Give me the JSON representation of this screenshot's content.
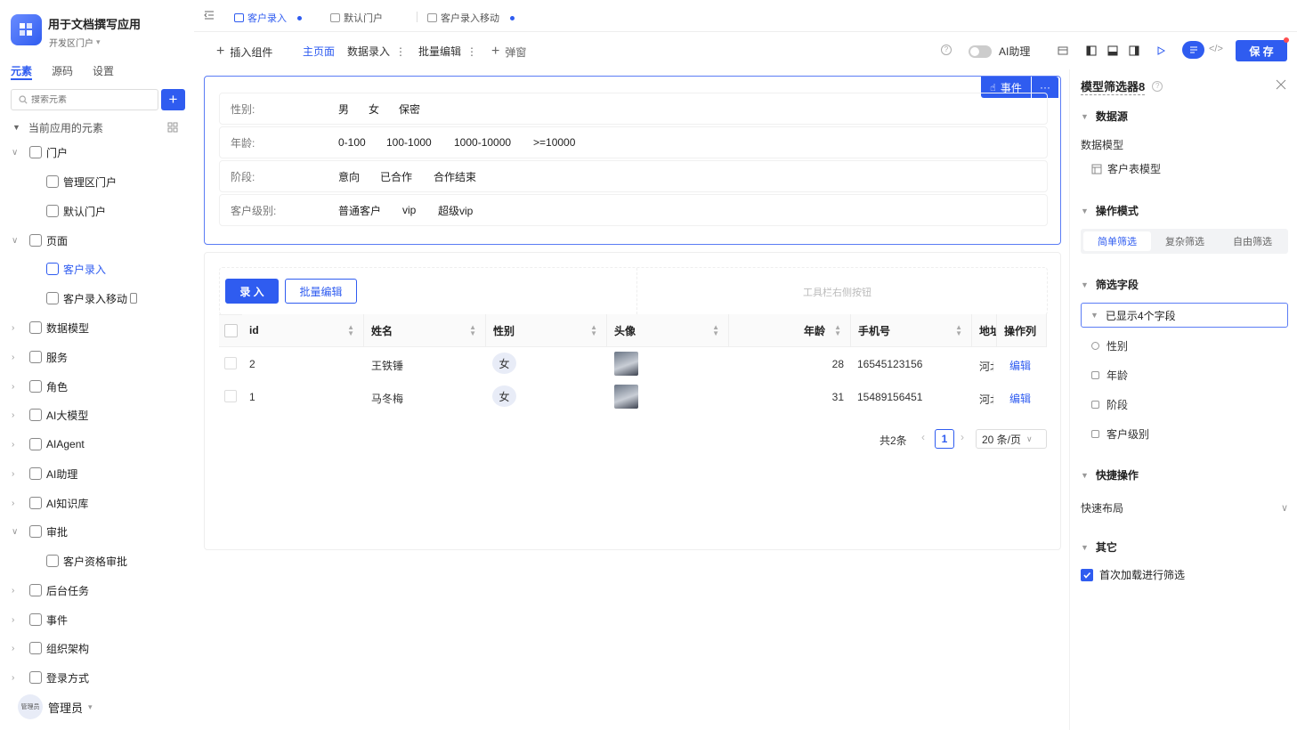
{
  "app": {
    "title": "用于文档撰写应用",
    "subtitle": "开发区门户"
  },
  "left_tabs": [
    "元素",
    "源码",
    "设置"
  ],
  "search": {
    "placeholder": "搜索元素"
  },
  "tree_header": "当前应用的元素",
  "tree": [
    {
      "label": "门户",
      "icon": "home-icon",
      "level": 0,
      "expanded": true
    },
    {
      "label": "管理区门户",
      "icon": "monitor-icon",
      "level": 1
    },
    {
      "label": "默认门户",
      "icon": "monitor-icon",
      "level": 1
    },
    {
      "label": "页面",
      "icon": "page-icon",
      "level": 0,
      "expanded": true
    },
    {
      "label": "客户录入",
      "icon": "page-web-icon",
      "level": 1,
      "selected": true
    },
    {
      "label": "客户录入移动",
      "icon": "page-web-icon",
      "level": 1,
      "mobile": true
    },
    {
      "label": "数据模型",
      "icon": "table-icon",
      "level": 0
    },
    {
      "label": "服务",
      "icon": "service-icon",
      "level": 0
    },
    {
      "label": "角色",
      "icon": "role-icon",
      "level": 0
    },
    {
      "label": "AI大模型",
      "icon": "cube-icon",
      "level": 0
    },
    {
      "label": "AIAgent",
      "icon": "robot-icon",
      "level": 0
    },
    {
      "label": "AI助理",
      "icon": "ai-icon",
      "level": 0
    },
    {
      "label": "AI知识库",
      "icon": "book-icon",
      "level": 0
    },
    {
      "label": "审批",
      "icon": "stamp-icon",
      "level": 0,
      "expanded": true
    },
    {
      "label": "客户资格审批",
      "icon": "stamp-icon",
      "level": 1
    },
    {
      "label": "后台任务",
      "icon": "task-icon",
      "level": 0
    },
    {
      "label": "事件",
      "icon": "event-icon",
      "level": 0
    },
    {
      "label": "组织架构",
      "icon": "org-icon",
      "level": 0
    },
    {
      "label": "登录方式",
      "icon": "login-icon",
      "level": 0
    }
  ],
  "user": {
    "name": "管理员",
    "avatar_text": "管理员"
  },
  "top_tabs": [
    {
      "label": "客户录入",
      "active": true,
      "dot": true
    },
    {
      "label": "默认门户",
      "active": false,
      "dot": false
    },
    {
      "label": "客户录入移动",
      "active": false,
      "dot": true
    }
  ],
  "toolbar": {
    "insert": "插入组件",
    "main_page": "主页面",
    "data_entry": "数据录入",
    "batch_edit": "批量编辑",
    "popup": "弹窗",
    "ai_assistant": "AI助理",
    "save": "保 存"
  },
  "filter": {
    "event_button": "事件",
    "rows": [
      {
        "label": "性别:",
        "options": [
          "男",
          "女",
          "保密"
        ]
      },
      {
        "label": "年龄:",
        "options": [
          "0-100",
          "100-1000",
          "1000-10000",
          ">=10000"
        ]
      },
      {
        "label": "阶段:",
        "options": [
          "意向",
          "已合作",
          "合作结束"
        ]
      },
      {
        "label": "客户级别:",
        "options": [
          "普通客户",
          "vip",
          "超级vip"
        ]
      }
    ]
  },
  "table": {
    "btn_entry": "录 入",
    "btn_batch": "批量编辑",
    "toolbar_right_hint": "工具栏右侧按钮",
    "columns": [
      "id",
      "姓名",
      "性别",
      "头像",
      "年龄",
      "手机号",
      "地址",
      "操作列"
    ],
    "rows": [
      {
        "id": "2",
        "name": "王铁锤",
        "gender": "女",
        "age": "28",
        "phone": "16545123156",
        "address": "河北",
        "action": "编辑"
      },
      {
        "id": "1",
        "name": "马冬梅",
        "gender": "女",
        "age": "31",
        "phone": "15489156451",
        "address": "河北",
        "action": "编辑"
      }
    ],
    "pagination": {
      "total": "共2条",
      "page": "1",
      "page_size": "20 条/页"
    }
  },
  "right_panel": {
    "title": "模型筛选器8",
    "sec_datasource": "数据源",
    "data_model_label": "数据模型",
    "data_model_value": "客户表模型",
    "sec_mode": "操作模式",
    "modes": [
      "简单筛选",
      "复杂筛选",
      "自由筛选"
    ],
    "sec_fields": "筛选字段",
    "fields_summary": "已显示4个字段",
    "fields": [
      "性别",
      "年龄",
      "阶段",
      "客户级别"
    ],
    "sec_quick": "快捷操作",
    "quick_layout": "快速布局",
    "sec_other": "其它",
    "first_load_filter": "首次加载进行筛选"
  },
  "colors": {
    "accent": "#2f5cf0",
    "border_accent": "#5b7cf5",
    "save_dot": "#ff4d4f"
  }
}
